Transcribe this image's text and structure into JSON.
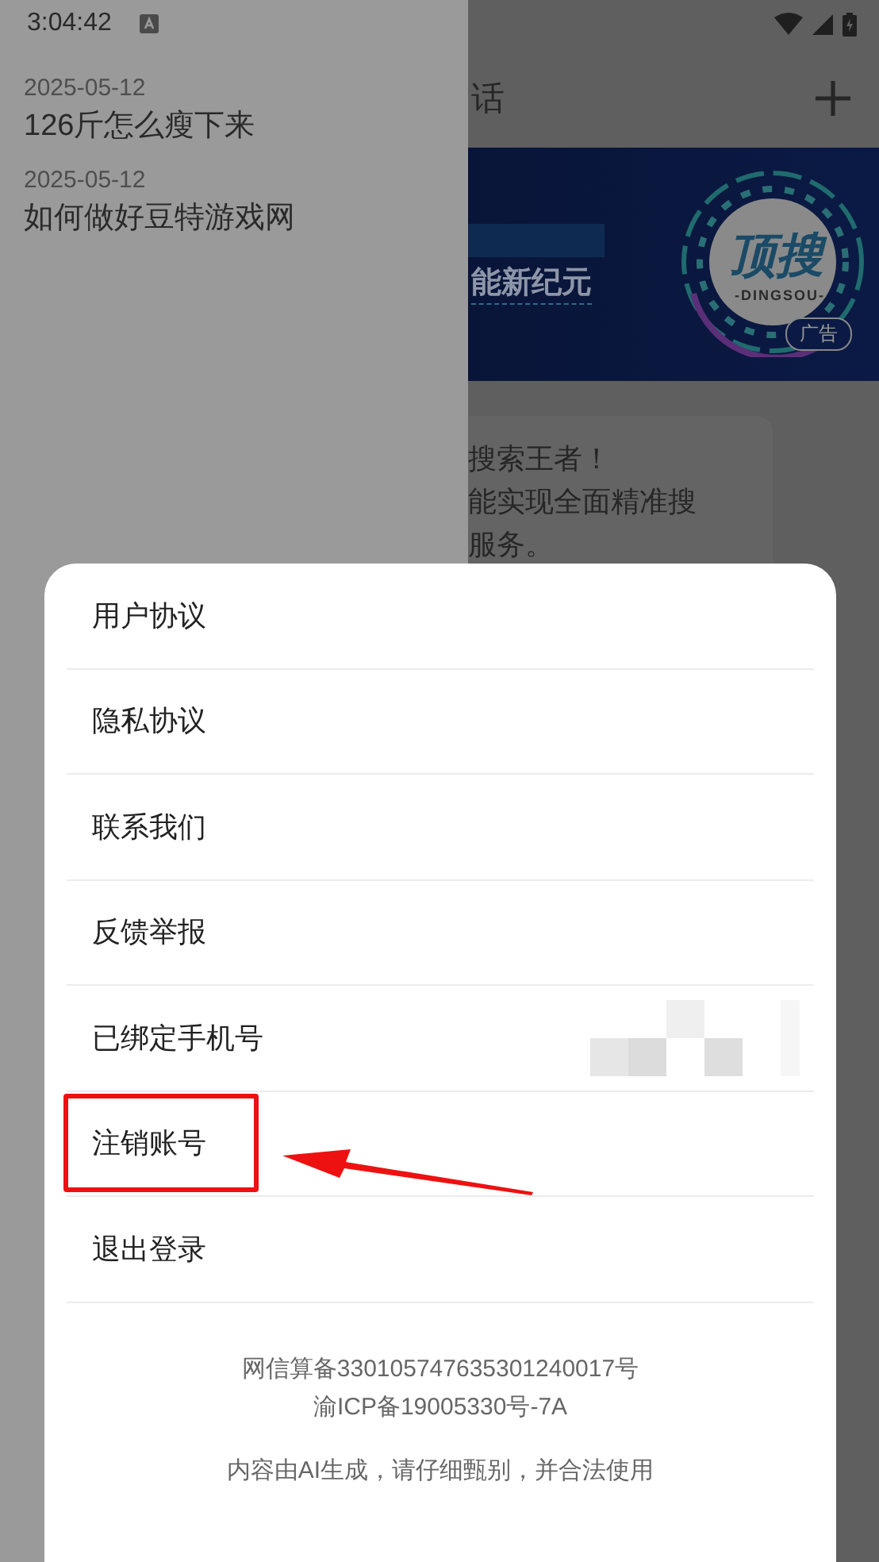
{
  "status_bar": {
    "time": "3:04:42"
  },
  "drawer": {
    "history": [
      {
        "date": "2025-05-12",
        "title": "126斤怎么瘦下来"
      },
      {
        "date": "2025-05-12",
        "title": "如何做好豆特游戏网"
      }
    ]
  },
  "main": {
    "header_title": "话",
    "banner": {
      "headline": "能新纪元",
      "logo_text": "顶搜",
      "logo_subtext": "-DINGSOU-",
      "ad_badge": "广告"
    },
    "card_lines": [
      "搜索王者！",
      "能实现全面精准搜",
      "服务。"
    ]
  },
  "sheet": {
    "items": [
      {
        "label": "用户协议",
        "highlighted": false,
        "redacted_value": false
      },
      {
        "label": "隐私协议",
        "highlighted": false,
        "redacted_value": false
      },
      {
        "label": "联系我们",
        "highlighted": false,
        "redacted_value": false
      },
      {
        "label": "反馈举报",
        "highlighted": false,
        "redacted_value": false
      },
      {
        "label": "已绑定手机号",
        "highlighted": false,
        "redacted_value": true
      },
      {
        "label": "注销账号",
        "highlighted": true,
        "redacted_value": false
      },
      {
        "label": "退出登录",
        "highlighted": false,
        "redacted_value": false
      }
    ],
    "footer": [
      "网信算备330105747635301240017号",
      "渝ICP备19005330号-7A",
      "内容由AI生成，请仔细甄别，并合法使用"
    ]
  }
}
